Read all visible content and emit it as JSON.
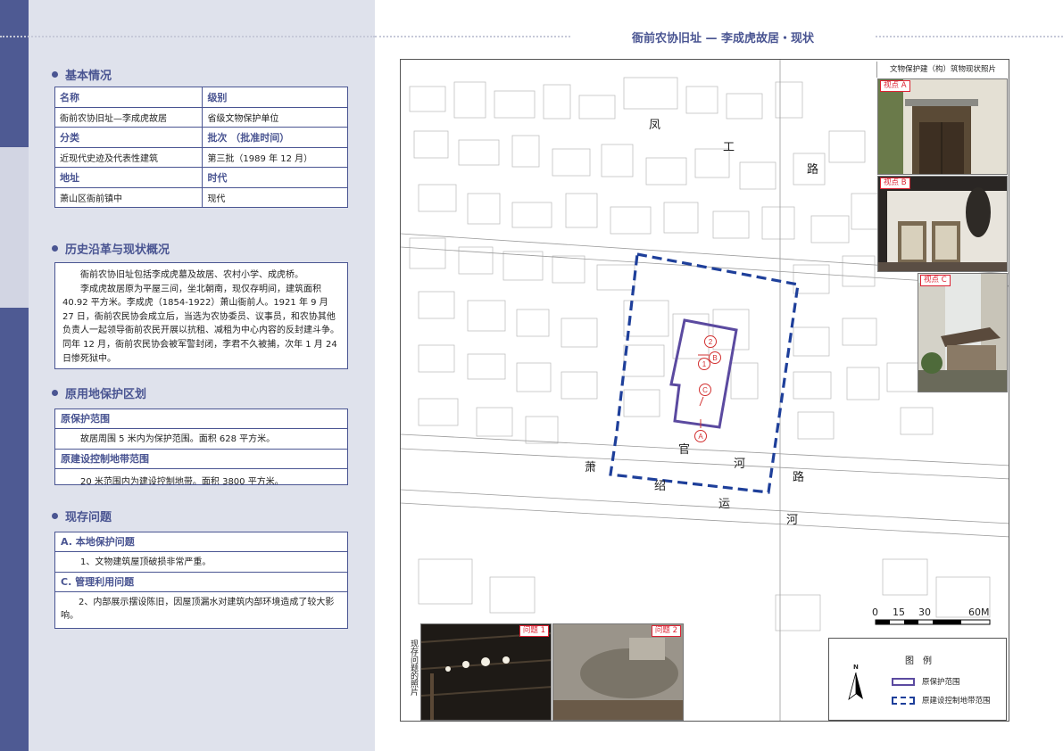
{
  "page_title": "衙前农协旧址 — 李成虎故居・现状",
  "sections": {
    "basic": "基本情况",
    "history": "历史沿革与现状概况",
    "protect": "原用地保护区划",
    "issues": "现存问题"
  },
  "info_table": {
    "name_label": "名称",
    "level_label": "级别",
    "name": "衙前农协旧址—李成虎故居",
    "level": "省级文物保护单位",
    "category_label": "分类",
    "batch_label": "批次 （批准时间）",
    "category": "近现代史迹及代表性建筑",
    "batch": "第三批（1989 年 12 月）",
    "address_label": "地址",
    "era_label": "时代",
    "address": "萧山区衙前镇中",
    "era": "现代"
  },
  "history_text": [
    "衙前农协旧址包括李成虎墓及故居、农村小学、成虎桥。",
    "李成虎故居原为平屋三间，坐北朝南，现仅存明间，建筑面积 40.92 平方米。李成虎（1854-1922）萧山衙前人。1921 年 9 月 27 日，衙前农民协会成立后，当选为农协委员、议事员，和农协其他负责人一起领导衙前农民开展以抗租、减租为中心内容的反封建斗争。同年 12 月，衙前农民协会被军警封闭，李君不久被捕，次年 1 月 24 日惨死狱中。"
  ],
  "protect": {
    "original_label": "原保护范围",
    "original_text": "故居周围 5 米内为保护范围。面积 628 平方米。",
    "control_label": "原建设控制地带范围",
    "control_text": "20 米范围内为建设控制地带。面积 3800 平方米。"
  },
  "issues": {
    "a_label": "A. 本地保护问题",
    "a_text": "1、文物建筑屋顶破损非常严重。",
    "c_label": "C. 管理利用问题",
    "c_text": "2、内部展示摆设陈旧，因屋顶漏水对建筑内部环境造成了较大影响。"
  },
  "map": {
    "photo_panel_title": "文物保护建（构）筑物现状照片",
    "viewpoints": [
      "视点 A",
      "视点 B",
      "视点 C"
    ],
    "markers": [
      "A",
      "B",
      "C",
      "1",
      "2"
    ],
    "road_chars": [
      "凤",
      "工",
      "路",
      "官",
      "河",
      "路",
      "萧",
      "绍",
      "运",
      "河"
    ],
    "scale_labels": [
      "0",
      "15",
      "30",
      "60M"
    ],
    "issue_photos_label": "现存问题的照片",
    "issue_tags": [
      "问题 1",
      "问题 2"
    ],
    "north": "N",
    "legend_title": "图　例",
    "legend_items": [
      "原保护范围",
      "原建设控制地带范围"
    ],
    "colors": {
      "protect": "#5b4aa0",
      "control": "#1e3f9a",
      "accent": "#4a5592",
      "marker": "#d23030"
    }
  }
}
